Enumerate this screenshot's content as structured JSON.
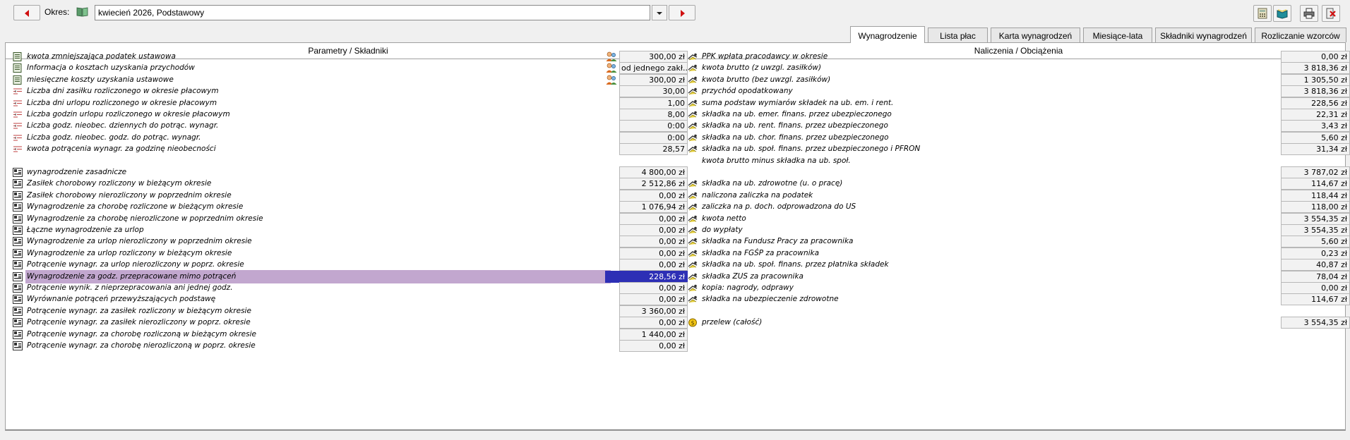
{
  "toolbar": {
    "okres_label": "Okres:",
    "period_value": "kwiecień 2026, Podstawowy",
    "icons": [
      "prev-arrow-icon",
      "calendar-book-icon",
      "dropdown-icon",
      "next-arrow-icon",
      "calculator-icon",
      "book-icon",
      "printer-icon",
      "exit-icon"
    ]
  },
  "tabs": [
    "Wynagrodzenie",
    "Lista płac",
    "Karta wynagrodzeń",
    "Miesiące-lata",
    "Składniki wynagrodzeń",
    "Rozliczanie wzorców"
  ],
  "headers": {
    "left": "Parametry / Składniki",
    "right": "Naliczenia / Obciążenia"
  },
  "left_rows": [
    {
      "label": "kwota zmniejszająca podatek ustawowa",
      "value": "300,00 zł",
      "icon": "document-icon",
      "person": true
    },
    {
      "label": "Informacja o kosztach uzyskania przychodów",
      "value": "od jednego zakł...",
      "icon": "document-icon",
      "person": true
    },
    {
      "label": "miesięczne koszty uzyskania ustawowe",
      "value": "300,00 zł",
      "icon": "document-icon",
      "person": true
    },
    {
      "label": "Liczba dni zasiłku rozliczonego w okresie płacowym",
      "value": "30,00",
      "icon": "parameter-icon"
    },
    {
      "label": "Liczba dni urlopu rozliczonego w okresie płacowym",
      "value": "1,00",
      "icon": "parameter-icon"
    },
    {
      "label": "Liczba godzin urlopu rozliczonego w okresie płacowym",
      "value": "8,00",
      "icon": "parameter-icon"
    },
    {
      "label": "Liczba godz. nieobec. dziennych do potrąc. wynagr.",
      "value": "0:00",
      "icon": "parameter-icon"
    },
    {
      "label": "Liczba godz. nieobec. godz. do potrąc. wynagr.",
      "value": "0:00",
      "icon": "parameter-icon"
    },
    {
      "label": "kwota potrącenia wynagr. za godzinę nieobecności",
      "value": "28,57",
      "icon": "parameter-icon"
    },
    {
      "label": "wynagrodzenie zasadnicze",
      "value": "4 800,00 zł",
      "icon": "component-icon"
    },
    {
      "label": "Zasiłek chorobowy rozliczony w bieżącym okresie",
      "value": "2 512,86 zł",
      "icon": "component-icon"
    },
    {
      "label": "Zasiłek chorobowy nierozliczony w poprzednim okresie",
      "value": "0,00 zł",
      "icon": "component-icon"
    },
    {
      "label": "Wynagrodzenie za chorobę rozliczone w bieżącym okresie",
      "value": "1 076,94 zł",
      "icon": "component-icon"
    },
    {
      "label": "Wynagrodzenie za chorobę nierozliczone w poprzednim okresie",
      "value": "0,00 zł",
      "icon": "component-icon"
    },
    {
      "label": "Łączne wynagrodzenie za urlop",
      "value": "0,00 zł",
      "icon": "component-icon"
    },
    {
      "label": "Wynagrodzenie za urlop nierozliczony w poprzednim okresie",
      "value": "0,00 zł",
      "icon": "component-icon"
    },
    {
      "label": "Wynagrodzenie za urlop rozliczony w bieżącym okresie",
      "value": "0,00 zł",
      "icon": "component-icon"
    },
    {
      "label": "Potrącenie wynagr. za urlop nierozliczony w poprz. okresie",
      "value": "0,00 zł",
      "icon": "component-icon"
    },
    {
      "label": "Wynagrodzenie za godz. przepracowane mimo potrąceń",
      "value": "228,56 zł",
      "icon": "component-icon",
      "selected": true
    },
    {
      "label": "Potrącenie wynik. z nieprzepracowania ani jednej godz.",
      "value": "0,00 zł",
      "icon": "component-icon"
    },
    {
      "label": "Wyrównanie potrąceń przewyższających podstawę",
      "value": "0,00 zł",
      "icon": "component-icon"
    },
    {
      "label": "Potrącenie wynagr. za zasiłek rozliczony w bieżącym okresie",
      "value": "3 360,00 zł",
      "icon": "component-icon"
    },
    {
      "label": "Potrącenie wynagr. za zasiłek nierozliczony w poprz. okresie",
      "value": "0,00 zł",
      "icon": "component-icon"
    },
    {
      "label": "Potrącenie wynagr. za chorobę rozliczoną w bieżącym okresie",
      "value": "1 440,00 zł",
      "icon": "component-icon"
    },
    {
      "label": "Potrącenie wynagr. za chorobę nierozliczoną w poprz. okresie",
      "value": "0,00 zł",
      "icon": "component-icon"
    }
  ],
  "right_rows": [
    {
      "label": "PPK wpłata pracodawcy w okresie",
      "value": "0,00 zł",
      "icon": "calculation-icon"
    },
    {
      "label": "kwota brutto (z uwzgl. zasiłków)",
      "value": "3 818,36 zł",
      "icon": "calculation-icon"
    },
    {
      "label": "kwota brutto (bez uwzgl. zasiłków)",
      "value": "1 305,50 zł",
      "icon": "calculation-icon"
    },
    {
      "label": "przychód opodatkowany",
      "value": "3 818,36 zł",
      "icon": "calculation-icon"
    },
    {
      "label": "suma podstaw wymiarów składek na ub. em. i rent.",
      "value": "228,56 zł",
      "icon": "calculation-icon"
    },
    {
      "label": "składka na ub. emer. finans. przez ubezpieczonego",
      "value": "22,31 zł",
      "icon": "calculation-icon"
    },
    {
      "label": "składka na ub. rent. finans. przez ubezpieczonego",
      "value": "3,43 zł",
      "icon": "calculation-icon"
    },
    {
      "label": "składka na ub. chor. finans. przez ubezpieczonego",
      "value": "5,60 zł",
      "icon": "calculation-icon"
    },
    {
      "label": "składka na ub. społ. finans. przez ubezpieczonego i PFRON",
      "value": "31,34 zł",
      "icon": "calculation-icon"
    },
    {
      "label": "kwota brutto minus składka na ub. społ.",
      "value": "",
      "icon": "",
      "no_box": true
    },
    {
      "label": "",
      "value": "3 787,02 zł",
      "icon": ""
    },
    {
      "label": "składka na ub. zdrowotne (u. o pracę)",
      "value": "114,67 zł",
      "icon": "calculation-icon"
    },
    {
      "label": "naliczona zaliczka na podatek",
      "value": "118,44 zł",
      "icon": "calculation-icon"
    },
    {
      "label": "zaliczka na p. doch. odprowadzona do US",
      "value": "118,00 zł",
      "icon": "calculation-icon"
    },
    {
      "label": "kwota netto",
      "value": "3 554,35 zł",
      "icon": "calculation-icon"
    },
    {
      "label": "do wypłaty",
      "value": "3 554,35 zł",
      "icon": "calculation-icon"
    },
    {
      "label": "składka na Fundusz Pracy za pracownika",
      "value": "5,60 zł",
      "icon": "calculation-icon"
    },
    {
      "label": "składka na FGŚP za pracownika",
      "value": "0,23 zł",
      "icon": "calculation-icon"
    },
    {
      "label": "składka na ub. społ. finans. przez płatnika składek",
      "value": "40,87 zł",
      "icon": "calculation-icon"
    },
    {
      "label": "składka ZUS za pracownika",
      "value": "78,04 zł",
      "icon": "calculation-icon"
    },
    {
      "label": "kopia: nagrody, odprawy",
      "value": "0,00 zł",
      "icon": "calculation-icon"
    },
    {
      "label": "składka na ubezpieczenie zdrowotne",
      "value": "114,67 zł",
      "icon": "calculation-icon"
    },
    {
      "label": "",
      "value": "",
      "icon": "",
      "blank": true
    },
    {
      "label": "przelew (całość)",
      "value": "3 554,35 zł",
      "icon": "coin-icon"
    }
  ]
}
